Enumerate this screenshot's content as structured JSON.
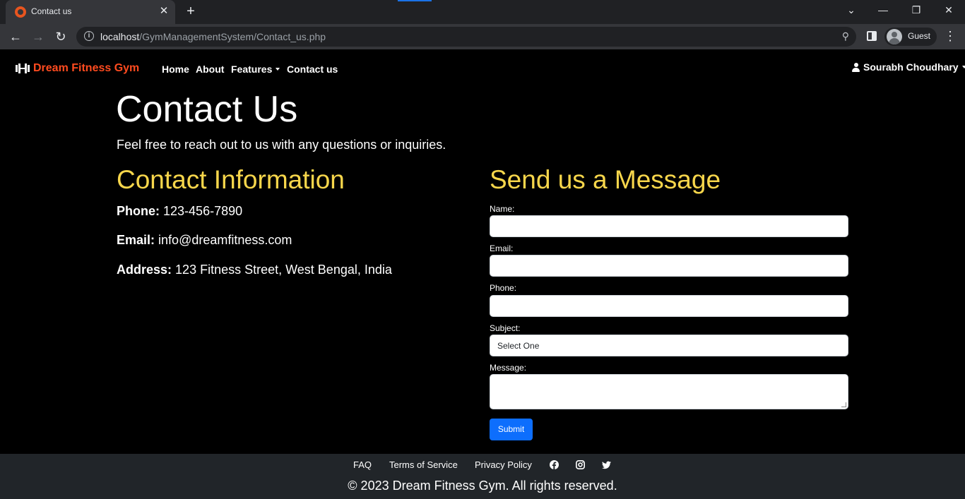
{
  "browser": {
    "tab_title": "Contact us",
    "url_host": "localhost",
    "url_path": "/GymManagementSystem/Contact_us.php",
    "profile_label": "Guest"
  },
  "nav": {
    "brand": "Dream Fitness Gym",
    "links": [
      "Home",
      "About",
      "Features",
      "Contact us"
    ],
    "user": "Sourabh Choudhary"
  },
  "page": {
    "title": "Contact Us",
    "lead": "Feel free to reach out to us with any questions or inquiries."
  },
  "contact_info": {
    "heading": "Contact Information",
    "phone_label": "Phone:",
    "phone": "123-456-7890",
    "email_label": "Email:",
    "email": "info@dreamfitness.com",
    "address_label": "Address:",
    "address": "123 Fitness Street, West Bengal, India"
  },
  "form": {
    "heading": "Send us a Message",
    "name_label": "Name:",
    "email_label": "Email:",
    "phone_label": "Phone:",
    "subject_label": "Subject:",
    "subject_selected": "Select One",
    "message_label": "Message:",
    "submit": "Submit"
  },
  "footer": {
    "links": [
      "FAQ",
      "Terms of Service",
      "Privacy Policy"
    ],
    "social": [
      "facebook-icon",
      "instagram-icon",
      "twitter-icon"
    ],
    "copyright": "© 2023 Dream Fitness Gym. All rights reserved."
  },
  "colors": {
    "brand": "#ff4b1f",
    "heading_accent": "#f7d64b",
    "primary_button": "#0d6efd",
    "footer_bg": "#212529"
  }
}
